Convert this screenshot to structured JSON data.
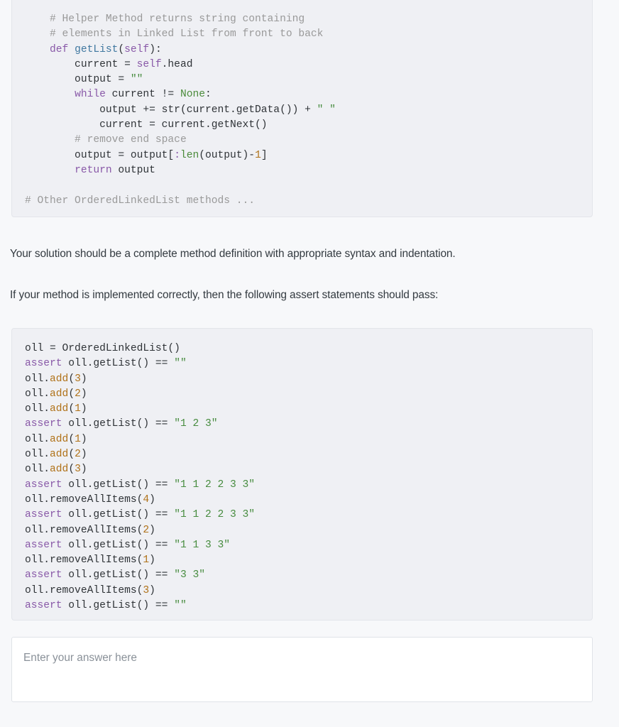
{
  "colors": {
    "page_background": "#f7f8fa",
    "code_background": "#eff0f4",
    "code_border": "#e3e5ea",
    "text": "#333a40",
    "comment": "#999999",
    "keyword": "#8959a8",
    "function_name": "#4078a0",
    "string": "#478c3f",
    "builtin": "#4b8b3b",
    "number": "#b07219",
    "method_call": "#b07219",
    "answer_box_background": "#ffffff",
    "answer_box_border": "#e0e3e8",
    "placeholder": "#8a9199"
  },
  "method_code": {
    "name": "helper-method-code",
    "language": "python",
    "plain_text": "    # Helper Method returns string containing\n    # elements in Linked List from front to back\n    def getList(self):\n        current = self.head\n        output = \"\"\n        while current != None:\n            output += str(current.getData()) + \" \"\n            current = current.getNext()\n        # remove end space\n        output = output[:len(output)-1]\n        return output\n\n# Other OrderedLinkedList methods ...",
    "lines": [
      "    # Helper Method returns string containing",
      "    # elements in Linked List from front to back",
      "    def getList(self):",
      "        current = self.head",
      "        output = \"\"",
      "        while current != None:",
      "            output += str(current.getData()) + \" \"",
      "            current = current.getNext()",
      "        # remove end space",
      "        output = output[:len(output)-1]",
      "        return output",
      "",
      "# Other OrderedLinkedList methods ..."
    ]
  },
  "prose": {
    "paragraph_1": "Your solution should be a complete method definition with appropriate syntax and indentation.",
    "paragraph_2": "If your method is implemented correctly, then the following assert statements should pass:"
  },
  "assert_code": {
    "name": "assert-statements-code",
    "language": "python",
    "plain_text": "oll = OrderedLinkedList()\nassert oll.getList() == \"\"\noll.add(3)\noll.add(2)\noll.add(1)\nassert oll.getList() == \"1 2 3\"\noll.add(1)\noll.add(2)\noll.add(3)\nassert oll.getList() == \"1 1 2 2 3 3\"\noll.removeAllItems(4)\nassert oll.getList() == \"1 1 2 2 3 3\"\noll.removeAllItems(2)\nassert oll.getList() == \"1 1 3 3\"\noll.removeAllItems(1)\nassert oll.getList() == \"3 3\"\noll.removeAllItems(3)\nassert oll.getList() == \"\"",
    "lines": [
      "oll = OrderedLinkedList()",
      "assert oll.getList() == \"\"",
      "oll.add(3)",
      "oll.add(2)",
      "oll.add(1)",
      "assert oll.getList() == \"1 2 3\"",
      "oll.add(1)",
      "oll.add(2)",
      "oll.add(3)",
      "assert oll.getList() == \"1 1 2 2 3 3\"",
      "oll.removeAllItems(4)",
      "assert oll.getList() == \"1 1 2 2 3 3\"",
      "oll.removeAllItems(2)",
      "assert oll.getList() == \"1 1 3 3\"",
      "oll.removeAllItems(1)",
      "assert oll.getList() == \"3 3\"",
      "oll.removeAllItems(3)",
      "assert oll.getList() == \"\""
    ]
  },
  "answer": {
    "placeholder": "Enter your answer here",
    "value": ""
  }
}
